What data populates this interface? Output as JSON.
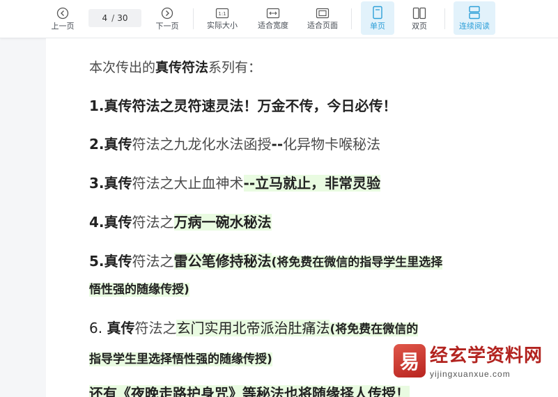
{
  "toolbar": {
    "prev_label": "上一页",
    "page_current": "4",
    "page_separator": "/",
    "page_total": "30",
    "next_label": "下一页",
    "actual_size_label": "实际大小",
    "fit_width_label": "适合宽度",
    "fit_page_label": "适合页面",
    "single_page_label": "单页",
    "double_page_label": "双页",
    "continuous_label": "连续阅读",
    "accent_color": "#2d9fd8"
  },
  "document": {
    "intro": {
      "a": "本次传出的",
      "b": "真传符法",
      "c": "系列有："
    },
    "items": [
      {
        "num": "1.",
        "a": "真传符法之灵符速灵法！万金不传，今日必传！"
      },
      {
        "num": "2.",
        "a": "真传",
        "b": "符法之九龙化水法函授",
        "c": "--",
        "d": "化异物卡喉秘法"
      },
      {
        "num": "3.",
        "a": "真传",
        "b": "符法之大止血神术",
        "c": "--立马就止，非常灵验"
      },
      {
        "num": "4.",
        "a": "真传",
        "b": "符法之",
        "c": "万病一碗水秘法"
      },
      {
        "num": "5.",
        "a": "真传",
        "b": "符法之",
        "c": "雷公笔修持秘法",
        "d": "(将免费在微信的指导学生里选择",
        "e": "悟性强的随缘传授)"
      },
      {
        "num": "6. ",
        "a": "真传",
        "b": "符法之",
        "c": "玄门实用北帝派治肚痛法",
        "d": "(将免费在微信的",
        "e": "指导学生里选择悟性强的随缘传授)"
      }
    ],
    "last_line": "还有《夜晚走路护身咒》等秘法也将随缘择人传授！"
  },
  "watermark": {
    "logo_glyph": "易",
    "title": "经玄学资料网",
    "url": "yijingxuanxue.com"
  }
}
